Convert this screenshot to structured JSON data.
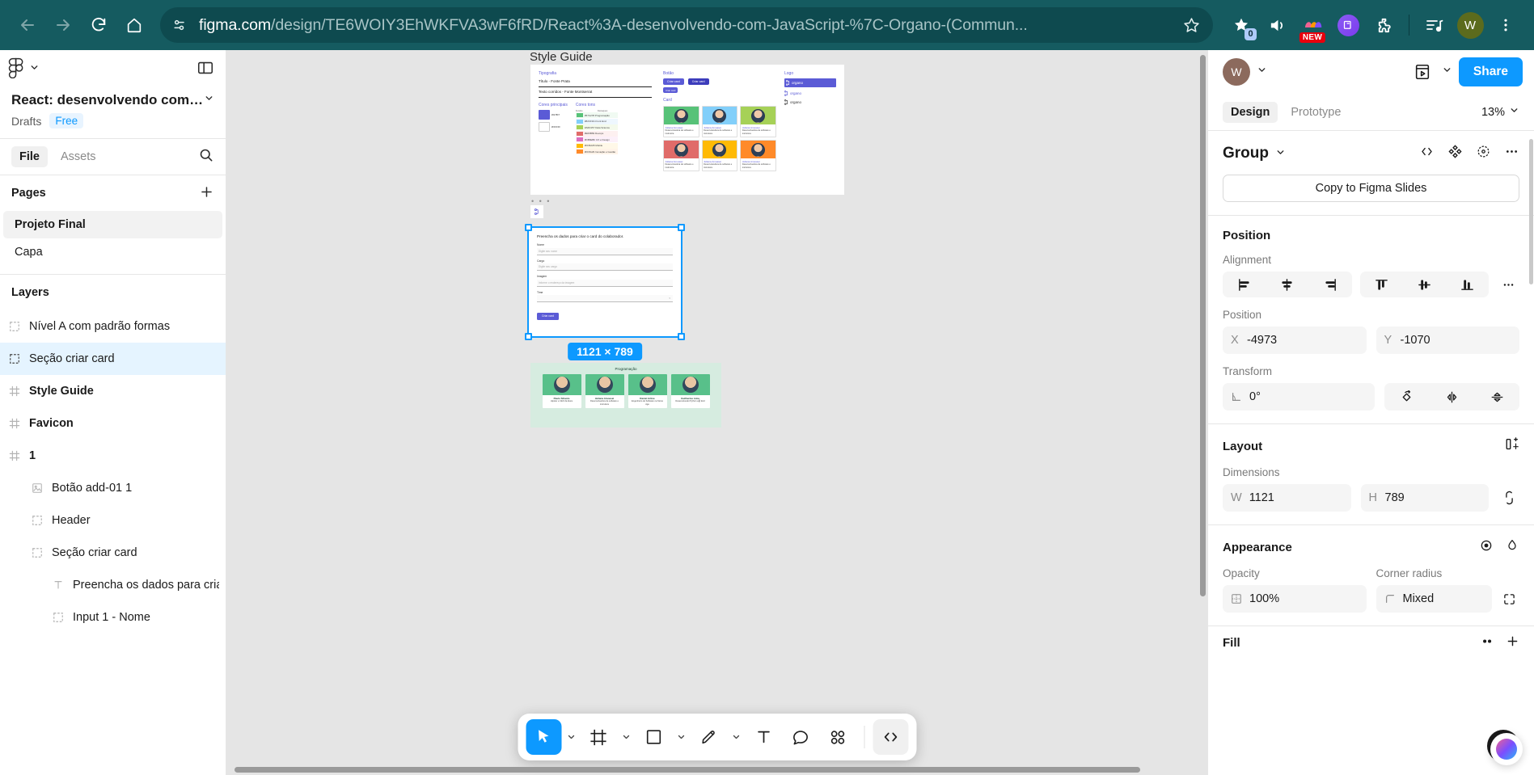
{
  "browser": {
    "back_icon": "arrow-left-icon",
    "forward_icon": "arrow-right-icon",
    "reload_icon": "reload-icon",
    "home_icon": "home-icon",
    "site_info_icon": "site-settings-icon",
    "url_domain": "figma.com",
    "url_path": "/design/TE6WOIY3EhWKFVA3wF6fRD/React%3A-desenvolvendo-com-JavaScript-%7C-Organo-(Commun...",
    "bookmark_icon": "star-outline-icon",
    "extensions": [
      {
        "name": "bookmark-star-icon",
        "badge": "0"
      },
      {
        "name": "volume-icon",
        "badge": ""
      },
      {
        "name": "new-extension-icon",
        "badge": "NEW"
      },
      {
        "name": "purple-extension-icon",
        "badge": ""
      },
      {
        "name": "puzzle-extension-icon",
        "badge": ""
      },
      {
        "name": "media-playlist-icon",
        "badge": ""
      }
    ],
    "profile_initial": "W",
    "menu_icon": "kebab-menu-icon"
  },
  "left_panel": {
    "figma_logo": "figma-logo-icon",
    "main_menu_chevron": "chevron-down-icon",
    "toggle_sidebar_icon": "panel-toggle-icon",
    "file_title": "React: desenvolvendo com ...",
    "file_title_chevron": "chevron-down-icon",
    "location": "Drafts",
    "plan_badge": "Free",
    "tabs": [
      {
        "label": "File",
        "active": true
      },
      {
        "label": "Assets",
        "active": false
      }
    ],
    "search_icon": "search-icon",
    "pages_title": "Pages",
    "add_page_icon": "plus-icon",
    "pages": [
      {
        "label": "Projeto Final",
        "selected": true
      },
      {
        "label": "Capa",
        "selected": false
      }
    ],
    "layers_title": "Layers",
    "layers": [
      {
        "label": "Nível A com padrão formas",
        "icon": "frame-dashed-icon",
        "indent": 0,
        "bold": false,
        "selected": false
      },
      {
        "label": "Seção criar card",
        "icon": "frame-dashed-icon",
        "indent": 0,
        "bold": false,
        "selected": true
      },
      {
        "label": "Style Guide",
        "icon": "hash-frame-icon",
        "indent": 0,
        "bold": true,
        "selected": false
      },
      {
        "label": "Favicon",
        "icon": "hash-frame-icon",
        "indent": 0,
        "bold": true,
        "selected": false
      },
      {
        "label": "1",
        "icon": "hash-frame-icon",
        "indent": 0,
        "bold": true,
        "selected": false
      },
      {
        "label": "Botão add-01 1",
        "icon": "image-icon",
        "indent": 1,
        "bold": false,
        "selected": false
      },
      {
        "label": "Header",
        "icon": "frame-dashed-icon",
        "indent": 1,
        "bold": false,
        "selected": false
      },
      {
        "label": "Seção criar card",
        "icon": "frame-dashed-icon",
        "indent": 1,
        "bold": false,
        "selected": false
      },
      {
        "label": "Preencha os dados para criar",
        "icon": "text-icon",
        "indent": 2,
        "bold": false,
        "selected": false
      },
      {
        "label": "Input 1 - Nome",
        "icon": "frame-dashed-icon",
        "indent": 2,
        "bold": false,
        "selected": false
      }
    ]
  },
  "canvas": {
    "style_guide_label": "Style Guide",
    "style_guide": {
      "col_typography": "Tipografia",
      "typo_title": "Título - Fonte Prata",
      "typo_body": "Texto corridos - Fonte Montserrat",
      "col_colors": "Cores principais",
      "col_tones": "Cores tons",
      "tones_header_left": "Fundos",
      "tones_header_right": "Destaques",
      "col_button": "Botão",
      "btn_primary": "Criar card",
      "btn_secondary": "Criar card",
      "btn_small": "Criar card",
      "col_card": "Card",
      "col_logo": "Logo",
      "logo_text": "organo",
      "tones": [
        {
          "hex": "#57C278",
          "name": "Programação"
        },
        {
          "hex": "#82CFFA",
          "name": "Front End"
        },
        {
          "hex": "#A6D157",
          "name": "Data Science"
        },
        {
          "hex": "#E06B69",
          "name": "Devops"
        },
        {
          "hex": "#DB6EBF",
          "name": "UX e Design"
        },
        {
          "hex": "#FFBA05",
          "name": "Mobile"
        },
        {
          "hex": "#FF8A29",
          "name": "Inovação e Gestão"
        }
      ],
      "card_name": "Juliana Amoasei",
      "card_role": "Desenvolvedora de software e instrutora"
    },
    "selected_frame": {
      "heading": "Preencha os dados para criar o card do colaborador.",
      "fields": [
        {
          "label": "Nome",
          "placeholder": "Digite seu nome"
        },
        {
          "label": "Cargo",
          "placeholder": "Digite seu cargo"
        },
        {
          "label": "Imagem",
          "placeholder": "Informe o endereço da imagem"
        },
        {
          "label": "Time",
          "placeholder": ""
        }
      ],
      "submit_label": "Criar card",
      "size_badge": "1121 × 789"
    },
    "prog_board": {
      "title": "Programação",
      "cards": [
        {
          "name": "Paulo Silveira",
          "role": "Hipster e CEO da Alura"
        },
        {
          "name": "Juliana Amoasei",
          "role": "Desenvolvedora de software e instrutora"
        },
        {
          "name": "Daniel Artine",
          "role": "Engenheiro de Software na Stone Age"
        },
        {
          "name": "Guilherme Lima",
          "role": "Desenvolvedor Python e前 End"
        }
      ]
    },
    "toolbar": [
      {
        "name": "move-tool",
        "icon": "cursor-icon",
        "active": true,
        "has_chevron": true
      },
      {
        "name": "frame-tool",
        "icon": "frame-icon",
        "active": false,
        "has_chevron": true
      },
      {
        "name": "shape-tool",
        "icon": "square-icon",
        "active": false,
        "has_chevron": true
      },
      {
        "name": "pen-tool",
        "icon": "pen-icon",
        "active": false,
        "has_chevron": true
      },
      {
        "name": "text-tool",
        "icon": "text-t-icon",
        "active": false,
        "has_chevron": false
      },
      {
        "name": "comment-tool",
        "icon": "comment-icon",
        "active": false,
        "has_chevron": false
      },
      {
        "name": "actions-tool",
        "icon": "grid-dots-icon",
        "active": false,
        "has_chevron": false
      },
      {
        "name": "dev-mode-tool",
        "icon": "code-brackets-icon",
        "active": false,
        "has_chevron": false
      }
    ],
    "help_label": "?"
  },
  "right_panel": {
    "user_initial": "W",
    "user_chevron": "chevron-down-icon",
    "present_icon": "present-play-icon",
    "present_chevron": "chevron-down-icon",
    "share_label": "Share",
    "tabs": [
      {
        "label": "Design",
        "active": true
      },
      {
        "label": "Prototype",
        "active": false
      }
    ],
    "zoom_level": "13%",
    "zoom_chevron": "chevron-down-icon",
    "object_type": "Group",
    "object_chevron": "chevron-down-icon",
    "object_icons": [
      "code-icon",
      "component-icon",
      "scope-icon",
      "more-icon"
    ],
    "copy_slides_label": "Copy to Figma Slides",
    "position": {
      "title": "Position",
      "alignment_label": "Alignment",
      "align_buttons": [
        "align-left-icon",
        "align-horizontal-center-icon",
        "align-right-icon",
        "align-top-icon",
        "align-vertical-center-icon",
        "align-bottom-icon"
      ],
      "align_more_icon": "more-icon",
      "position_label": "Position",
      "x_key": "X",
      "x_value": "-4973",
      "y_key": "Y",
      "y_value": "-1070",
      "transform_label": "Transform",
      "rotation_icon": "angle-icon",
      "rotation_value": "0°",
      "transform_buttons": [
        "rotate-icon",
        "flip-horizontal-icon",
        "flip-vertical-icon"
      ]
    },
    "layout": {
      "title": "Layout",
      "add_autolayout_icon": "add-auto-layout-icon",
      "dimensions_label": "Dimensions",
      "w_key": "W",
      "w_value": "1121",
      "h_key": "H",
      "h_value": "789",
      "link_icon": "link-ratio-icon"
    },
    "appearance": {
      "title": "Appearance",
      "visibility_icon": "eye-icon",
      "blend_icon": "blend-drop-icon",
      "opacity_label": "Opacity",
      "opacity_icon": "opacity-grid-icon",
      "opacity_value": "100%",
      "corner_label": "Corner radius",
      "corner_icon": "corner-radius-icon",
      "corner_value": "Mixed",
      "corner_expand_icon": "independent-corners-icon"
    },
    "fill": {
      "title": "Fill",
      "icons": [
        "style-icon",
        "add-icon"
      ]
    },
    "ai_icon": "ai-brain-icon"
  },
  "colors": {
    "browser_chrome": "#155b60",
    "accent_blue": "#0d99ff",
    "selection_blue": "#0d99ff",
    "canvas_bg": "#e5e5e5",
    "panel_bg": "#ffffff"
  }
}
